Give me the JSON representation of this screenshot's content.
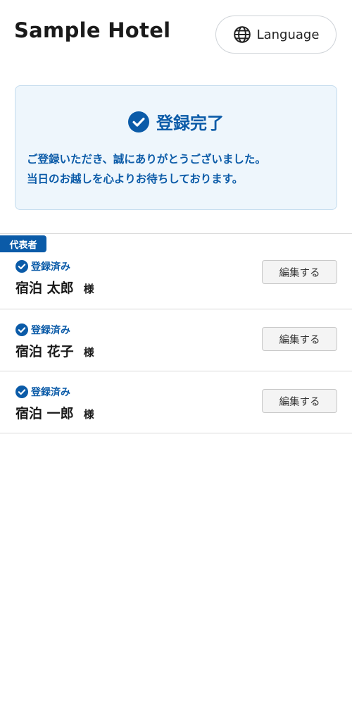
{
  "header": {
    "title": "Sample Hotel",
    "language_label": "Language"
  },
  "notice": {
    "title": "登録完了",
    "message_line1": "ご登録いただき、誠にありがとうございました。",
    "message_line2": "当日のお越しを心よりお待ちしております。"
  },
  "guests": [
    {
      "tag": "代表者",
      "status": "登録済み",
      "name": "宿泊 太郎",
      "honorific": "様",
      "edit_label": "編集する"
    },
    {
      "status": "登録済み",
      "name": "宿泊 花子",
      "honorific": "様",
      "edit_label": "編集する"
    },
    {
      "status": "登録済み",
      "name": "宿泊 一郎",
      "honorific": "様",
      "edit_label": "編集する"
    }
  ],
  "colors": {
    "accent": "#0b5ba8",
    "notice_bg": "#eef6fc"
  },
  "icons": {
    "language": "globe-icon",
    "status": "check-circle-icon"
  }
}
